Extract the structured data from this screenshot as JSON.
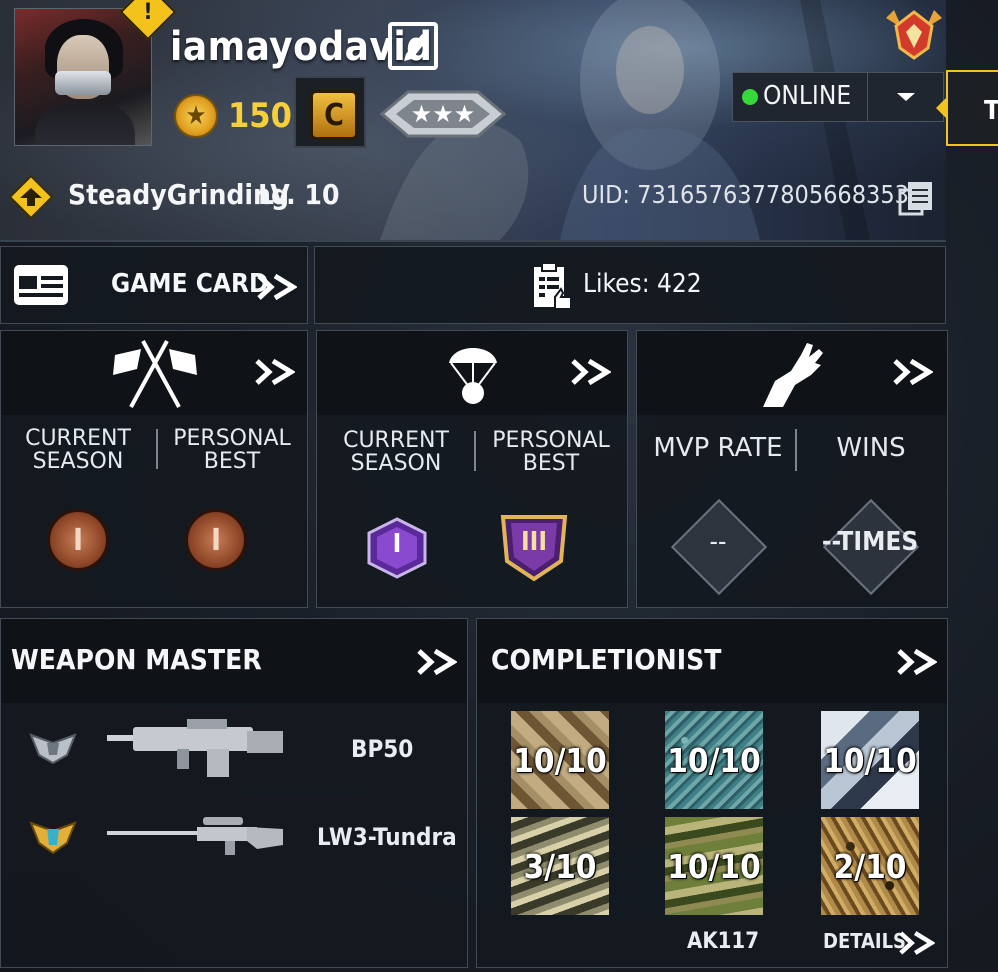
{
  "profile": {
    "username": "iamayodavid",
    "coins": "150",
    "nickname": "SteadyGrinding",
    "level": "LV. 10",
    "uid": "UID: 7316576377805668353",
    "status": "ONLINE",
    "side_tab_letter": "T",
    "alert_symbol": "!",
    "rank_badge_letter": "C"
  },
  "actions": {
    "game_card": "GAME CARD",
    "likes": "Likes:  422"
  },
  "stats": {
    "panel1": {
      "col1": "CURRENT SEASON",
      "col2": "PERSONAL BEST",
      "badge1": "I",
      "badge2": "I"
    },
    "panel2": {
      "col1": "CURRENT SEASON",
      "col2": "PERSONAL BEST",
      "badge1": "I",
      "badge2": "III"
    },
    "panel3": {
      "col1": "MVP RATE",
      "col2": "WINS",
      "value1": "--",
      "value2": "--TIMES"
    }
  },
  "weapon_master": {
    "title": "WEAPON MASTER",
    "weapons": [
      {
        "name": "BP50"
      },
      {
        "name": "LW3-Tundra"
      }
    ]
  },
  "completionist": {
    "title": "COMPLETIONIST",
    "camos": [
      {
        "progress": "10/10"
      },
      {
        "progress": "10/10"
      },
      {
        "progress": "10/10"
      },
      {
        "progress": "3/10"
      },
      {
        "progress": "10/10"
      },
      {
        "progress": "2/10"
      }
    ],
    "weapon": "AK117",
    "details": "DETAILS"
  },
  "colors": {
    "online": "#36d83a",
    "coin": "#f6cf3a",
    "accent_yellow": "#f2c21d"
  }
}
